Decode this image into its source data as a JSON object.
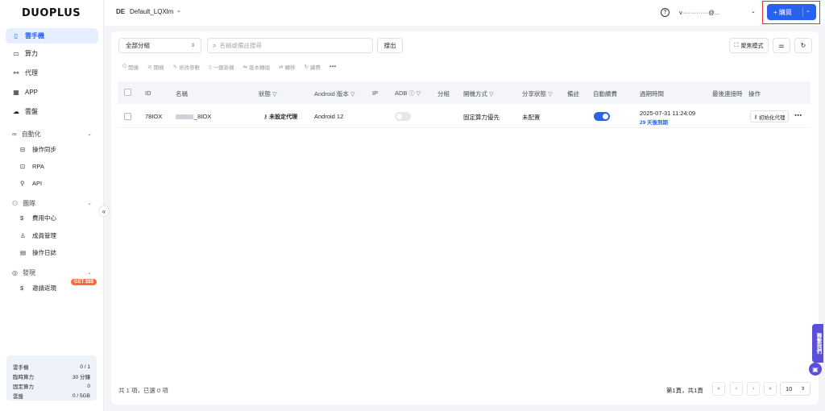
{
  "brand": {
    "logo": "DUOPLUS"
  },
  "sidebar": {
    "items": [
      {
        "label": "雲手機",
        "icon": "phone-icon"
      },
      {
        "label": "算力",
        "icon": "monitor-icon"
      },
      {
        "label": "代理",
        "icon": "network-icon"
      },
      {
        "label": "APP",
        "icon": "grid-icon"
      },
      {
        "label": "雲盤",
        "icon": "cloud-icon"
      }
    ],
    "automation": {
      "label": "自動化",
      "items": [
        "操作同步",
        "RPA",
        "API"
      ]
    },
    "team": {
      "label": "團隊",
      "items": [
        "費用中心",
        "成員管理",
        "操作日誌"
      ]
    },
    "discover": {
      "label": "發現",
      "items": [
        "邀請返現"
      ],
      "badge": "GET $$$"
    },
    "collapse": "«",
    "stats": [
      {
        "label": "雲手機",
        "value": "0 / 1"
      },
      {
        "label": "臨時算力",
        "value": "30 分鐘"
      },
      {
        "label": "固定算力",
        "value": "0"
      },
      {
        "label": "雲盤",
        "value": "0 / 5GB"
      }
    ]
  },
  "topbar": {
    "workspace_badge": "DE",
    "workspace_name": "Default_LQXlm",
    "user_email": "v·············@...",
    "buy_label": "+ 購買"
  },
  "toolbar": {
    "group_select": "全部分組",
    "search_placeholder": "名稱或備註搜尋",
    "search_button": "搜出",
    "focus_mode": "聚焦模式",
    "actions": [
      "開機",
      "關機",
      "修改參數",
      "一鍵新機",
      "版本轉換",
      "轉移",
      "續費"
    ]
  },
  "table": {
    "headers": {
      "id": "ID",
      "name": "名稱",
      "status": "狀態",
      "android": "Android 版本",
      "ip": "IP",
      "adb": "ADB",
      "group": "分組",
      "boot": "開機方式",
      "share": "分享狀態",
      "note": "備註",
      "renew": "自動續費",
      "expire": "過期時間",
      "last_connect": "最後連接時",
      "ops": "操作"
    },
    "rows": [
      {
        "id": "78IOX",
        "name_suffix": "_8IOX",
        "status": "未設定代理",
        "android": "Android 12",
        "adb_on": false,
        "boot": "固定算力優先",
        "share": "未配置",
        "renew_on": true,
        "expire_date": "2025-07-31 11:24:09",
        "expire_note": "29 天後到期",
        "init_proxy": "初始化代理"
      }
    ]
  },
  "footer": {
    "total": "共 1 項，已選 0 項",
    "page_info": "第1頁，共1頁",
    "page_size": "10"
  },
  "widgets": {
    "contact": "聯繫我們"
  },
  "colors": {
    "accent": "#2a62ef",
    "highlight_frame": "#e03434",
    "contact": "#5a4fd6"
  }
}
